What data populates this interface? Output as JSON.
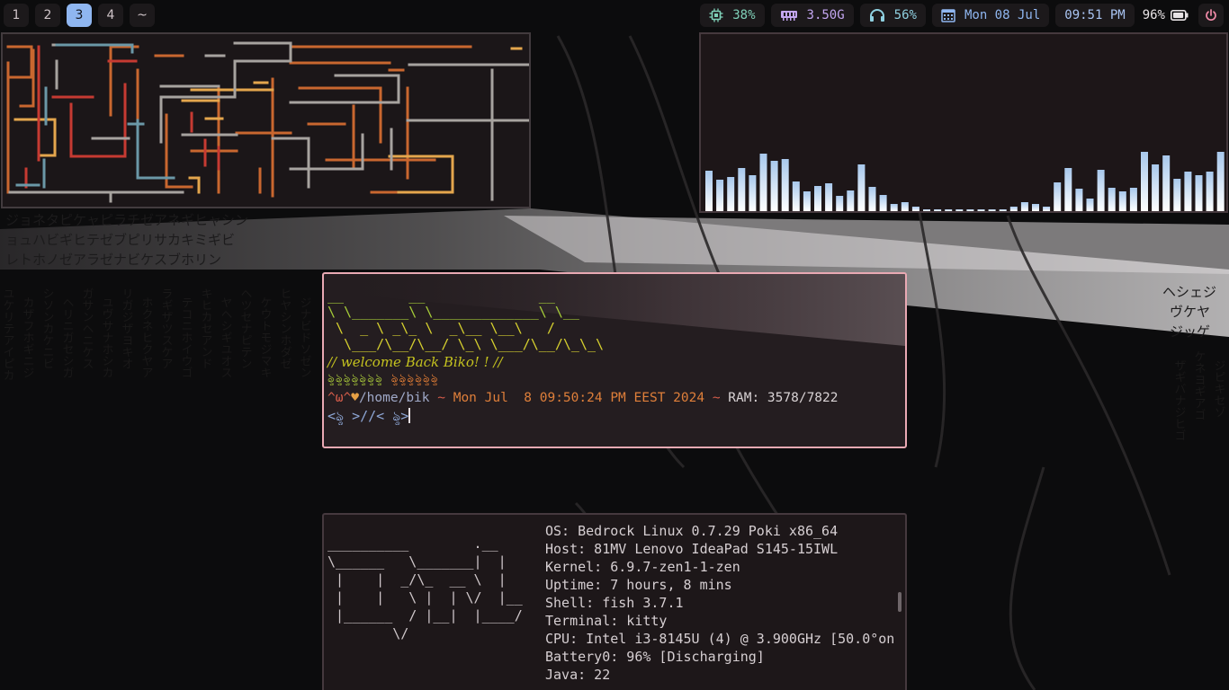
{
  "workspaces": [
    {
      "label": "1",
      "active": false
    },
    {
      "label": "2",
      "active": false
    },
    {
      "label": "3",
      "active": true
    },
    {
      "label": "4",
      "active": false
    },
    {
      "label": "~",
      "active": false
    }
  ],
  "status": {
    "cpu": {
      "value": "38%",
      "icon": "cpu-icon",
      "color": "#7fd0b8"
    },
    "memory": {
      "value": "3.50G",
      "icon": "memory-icon",
      "color": "#c3a6f0"
    },
    "audio": {
      "value": "56%",
      "icon": "headphones-icon",
      "color": "#8fd0e0"
    },
    "date": {
      "value": "Mon 08 Jul",
      "icon": "calendar-icon",
      "color": "#8fb6f0"
    },
    "time": {
      "value": "09:51 PM",
      "color": "#a9c4f2"
    },
    "battery": {
      "value": "96%",
      "icon": "battery-icon",
      "level": 0.96
    },
    "power": {
      "icon": "power-icon",
      "color": "#f08aa8"
    }
  },
  "visualizer": {
    "levels": [
      0.45,
      0.35,
      0.38,
      0.48,
      0.4,
      0.64,
      0.56,
      0.58,
      0.33,
      0.22,
      0.28,
      0.31,
      0.17,
      0.23,
      0.52,
      0.27,
      0.18,
      0.08,
      0.1,
      0.05,
      0.02,
      0.02,
      0.02,
      0.02,
      0.02,
      0.02,
      0.02,
      0.02,
      0.05,
      0.1,
      0.08,
      0.05,
      0.32,
      0.48,
      0.25,
      0.14,
      0.46,
      0.26,
      0.22,
      0.26,
      0.66,
      0.52,
      0.62,
      0.36,
      0.44,
      0.4,
      0.44,
      0.66
    ],
    "color_top": "#a8c8ec",
    "color_bottom": "#ffffff"
  },
  "terminal": {
    "ascii_art": [
      "__        __              __",
      "\\ \\_______\\ \\_____________\\ \\__",
      " \\  _ \\ _\\_ \\  _\\__ \\__\\   /",
      "  \\___/\\__/\\__/ \\_\\ \\___/\\__/\\_\\_\\"
    ],
    "welcome": "// welcome Back Biko! ! //",
    "ornament_left": "ৡৡৡৡৡৡৡ",
    "ornament_right": "ৡৡৡৡৡৡ",
    "prompt_face": "^ω^",
    "prompt_heart": "♥",
    "prompt_path": "/home/bik",
    "prompt_sep": "~",
    "prompt_date": "Mon Jul  8 09:50:24 PM EEST 2024",
    "prompt_sep2": "~",
    "prompt_ram": "RAM: 3578/7822",
    "input_prompt": "<ৡ >//< ৡ>"
  },
  "fetch": {
    "logo": [
      "__________        .__",
      "\\______   \\_______|  |",
      " |    |  _/\\_  __ \\  |",
      " |    |   \\ |  | \\/  |__",
      " |______  / |__|  |____/",
      "        \\/"
    ],
    "lines": [
      "OS: Bedrock Linux 0.7.29 Poki x86_64",
      "Host: 81MV Lenovo IdeaPad S145-15IWL",
      "Kernel: 6.9.7-zen1-1-zen",
      "Uptime: 7 hours, 8 mins",
      "Shell: fish 3.7.1",
      "Terminal: kitty",
      "CPU: Intel i3-8145U (4) @ 3.900GHz [50.0°on",
      "Battery0: 96% [Discharging]",
      "Java: 22"
    ]
  }
}
